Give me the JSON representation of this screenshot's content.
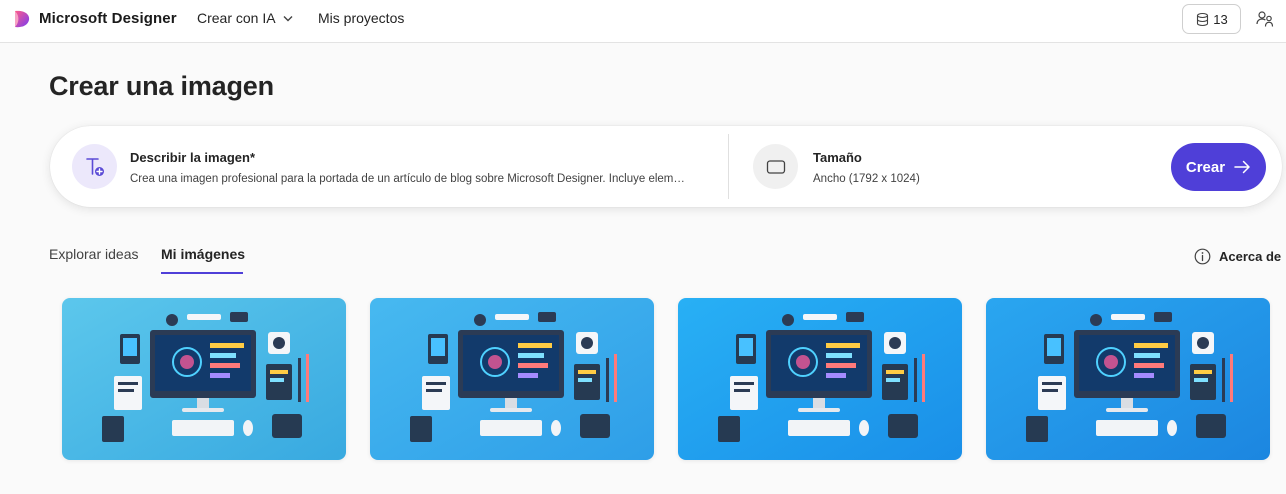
{
  "header": {
    "app_name": "Microsoft Designer",
    "nav": [
      {
        "label": "Crear con IA",
        "icon": "chevron-down-icon"
      },
      {
        "label": "Mis proyectos"
      }
    ],
    "credits": "13",
    "credits_icon": "coins-stack-icon",
    "share_icon": "share-people-icon"
  },
  "page": {
    "title": "Crear una imagen"
  },
  "prompt": {
    "describe_label": "Describir la imagen*",
    "describe_text": "Crea una imagen profesional para la portada de un artículo de blog sobre Microsoft Designer. Incluye elem…",
    "size_label": "Tamaño",
    "size_value": "Ancho (1792 x 1024)",
    "create_label": "Crear"
  },
  "tabs": [
    {
      "label": "Explorar ideas",
      "selected": false
    },
    {
      "label": "Mi imágenes",
      "selected": true
    }
  ],
  "about_label": "Acerca de",
  "images": [
    {
      "name": "generated-image-1",
      "colors": [
        "#5cc7ec",
        "#38a9e0"
      ]
    },
    {
      "name": "generated-image-2",
      "colors": [
        "#47b9f0",
        "#2e9ee8"
      ]
    },
    {
      "name": "generated-image-3",
      "colors": [
        "#28b0f5",
        "#1a8fe8"
      ]
    },
    {
      "name": "generated-image-4",
      "colors": [
        "#2aa6f0",
        "#1c86e0"
      ]
    }
  ],
  "colors": {
    "accent": "#4f3fd8",
    "accent_light": "#ece8fb"
  }
}
